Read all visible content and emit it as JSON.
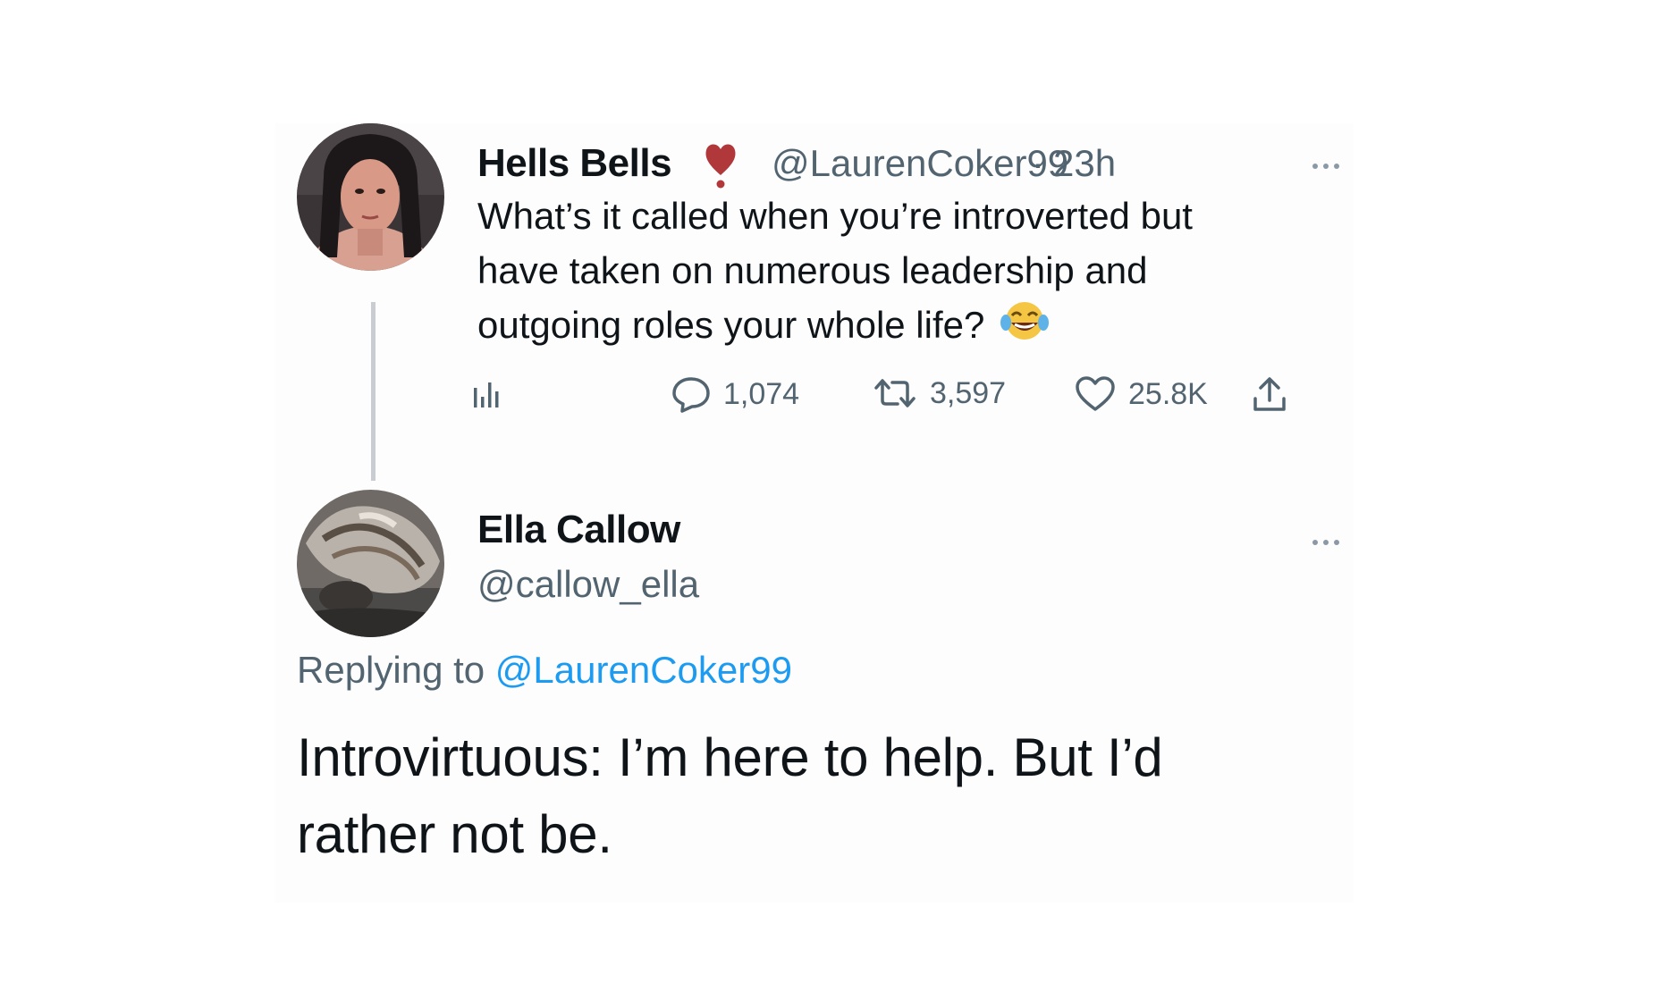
{
  "tweet": {
    "display_name": "Hells Bells",
    "badge_icon": "heart-exclamation-icon",
    "handle": "@LaurenCoker99",
    "separator": "·",
    "time": "23h",
    "text": "What’s it called when you’re introverted but have taken on numerous leadership and outgoing roles your whole life?",
    "emoji_icon": "laughing-tears-emoji",
    "stats": {
      "views_icon": "analytics-icon",
      "replies": "1,074",
      "retweets": "3,597",
      "likes": "25.8K",
      "share_icon": "share-icon"
    }
  },
  "reply": {
    "display_name": "Ella Callow",
    "handle": "@callow_ella",
    "replying_prefix": "Replying to",
    "replying_handle": "@LaurenCoker99",
    "text": "Introvirtuous: I’m here to help. But I’d rather not be."
  },
  "colors": {
    "text": "#0f1419",
    "secondary": "#536471",
    "link": "#1d9bf0",
    "badge": "#b0373a"
  }
}
